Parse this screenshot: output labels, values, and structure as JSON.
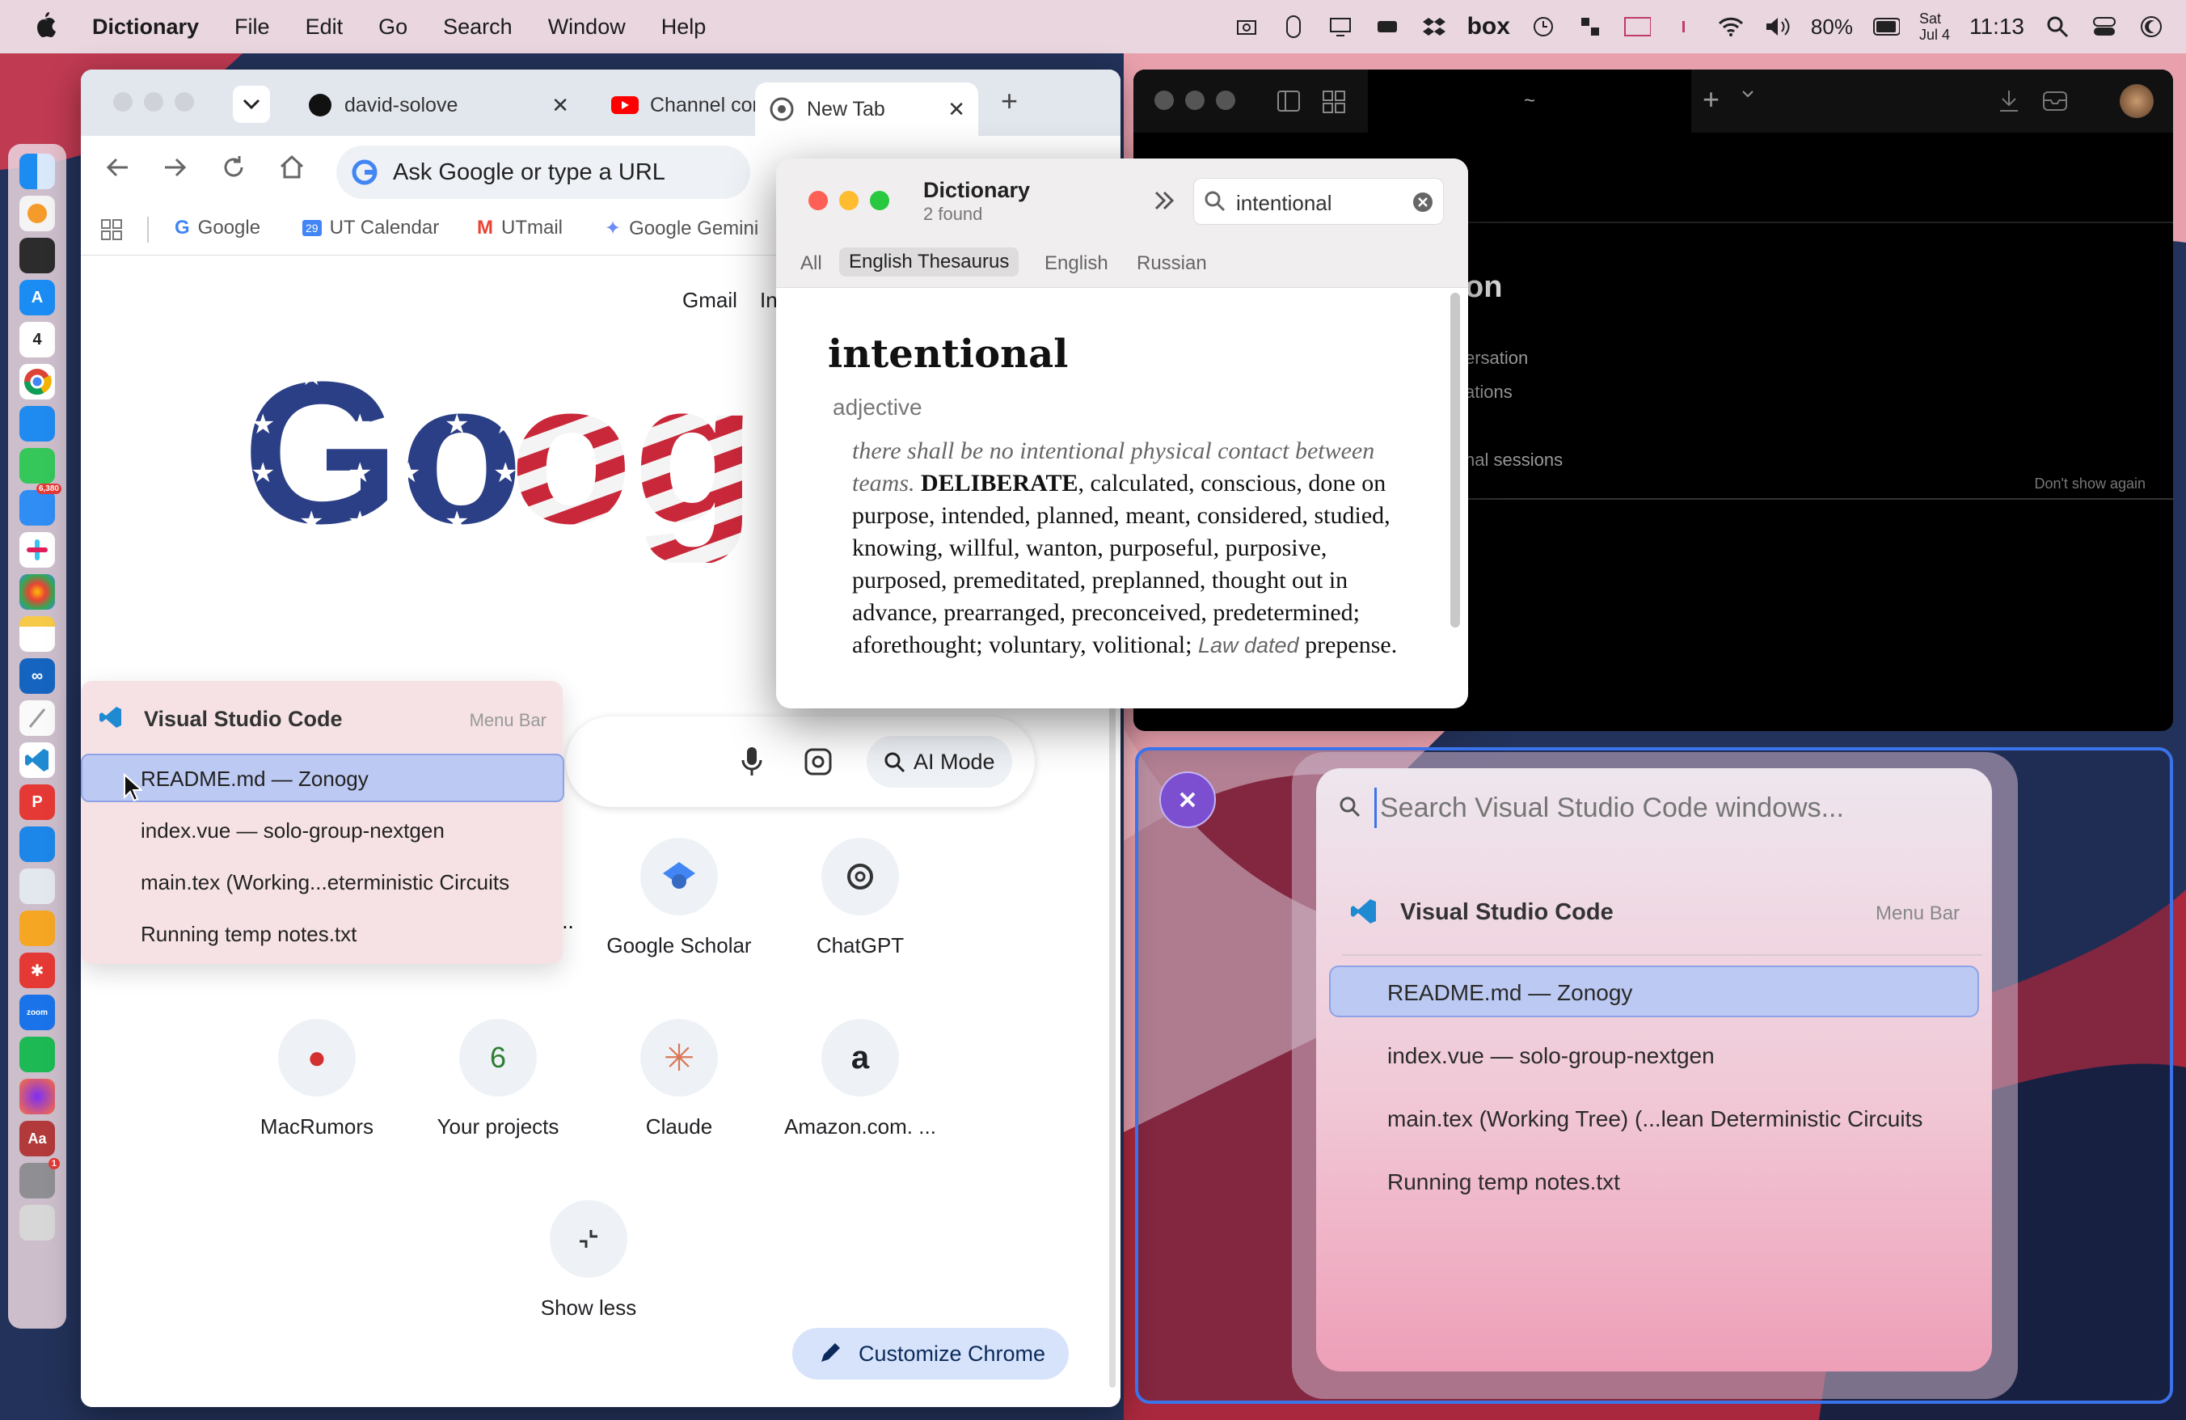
{
  "menubar": {
    "app_name": "Dictionary",
    "menus": [
      "File",
      "Edit",
      "Go",
      "Search",
      "Window",
      "Help"
    ],
    "battery": "80%",
    "date_day": "Sat",
    "date_date": "Jul 4",
    "time": "11:13",
    "box_label": "box"
  },
  "chrome": {
    "tabs": [
      {
        "label": "david-solove"
      },
      {
        "label": "Channel cont"
      },
      {
        "label": "New Tab"
      }
    ],
    "omnibox_placeholder": "Ask Google or type a URL",
    "bookmarks": [
      "Google",
      "UT Calendar",
      "UTmail",
      "Google Gemini"
    ],
    "top_links": [
      "Gmail",
      "In"
    ],
    "ai_mode_label": "AI Mode",
    "shortcuts_row1": [
      {
        "label": "Google Scholar"
      },
      {
        "label": "ChatGPT"
      }
    ],
    "shortcuts_row2": [
      {
        "label": "MacRumors"
      },
      {
        "label": "Your projects"
      },
      {
        "label": "Claude"
      },
      {
        "label": "Amazon.com. ..."
      }
    ],
    "show_less": "Show less",
    "customize": "Customize Chrome",
    "ellipsis": "..."
  },
  "dictionary": {
    "title": "Dictionary",
    "found": "2 found",
    "search_value": "intentional",
    "filters": [
      "All",
      "English Thesaurus",
      "English",
      "Russian"
    ],
    "active_filter": "English Thesaurus",
    "word": "intentional",
    "pos": "adjective",
    "example": "there shall be no intentional physical contact between teams.",
    "headword": "DELIBERATE",
    "synonyms": ", calculated, conscious, done on purpose, intended, planned, meant, considered, studied, knowing, willful, wanton, purposeful, purposive, purposed, premeditated, preplanned, thought out in advance, prearranged, preconceived, predetermined; aforethought; voluntary, volitional;",
    "register": "Law dated",
    "last_word": "prepense."
  },
  "vscode_menu": {
    "title": "Visual Studio Code",
    "tag": "Menu Bar",
    "items": [
      "README.md — Zonogy",
      "index.vue — solo-group-nextgen",
      "main.tex (Working...eterministic Circuits",
      "Running temp notes.txt"
    ]
  },
  "terminal": {
    "tab_title": "~",
    "heading_fragment": "on",
    "lines": [
      "ersation",
      "ations",
      "nal sessions"
    ],
    "dont_show": "Don't show again"
  },
  "switcher": {
    "search_placeholder": "Search Visual Studio Code windows...",
    "title": "Visual Studio Code",
    "tag": "Menu Bar",
    "items": [
      "README.md — Zonogy",
      "index.vue — solo-group-nextgen",
      "main.tex (Working Tree) (...lean Deterministic Circuits",
      "Running temp notes.txt"
    ]
  },
  "dock": {
    "calendar_day": "4",
    "mail_badge": "6,380",
    "settings_badge": "1"
  },
  "colors": {
    "accent_blue": "#3b73ea",
    "selection": "#bcc9f2",
    "chrome_tab_bg": "#e2e7ee"
  }
}
